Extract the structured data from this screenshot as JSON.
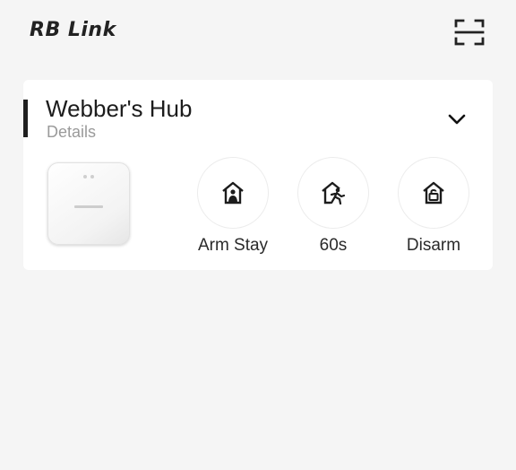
{
  "header": {
    "logo_text": "RB Link",
    "scan_icon": "scan-icon"
  },
  "hub_card": {
    "name": "Webber's Hub",
    "details_label": "Details",
    "expand_icon": "chevron-down-icon"
  },
  "modes": [
    {
      "label": "Arm Stay",
      "icon": "home-person-icon"
    },
    {
      "label": "60s",
      "icon": "home-leave-icon"
    },
    {
      "label": "Disarm",
      "icon": "home-unlock-icon"
    }
  ],
  "colors": {
    "background": "#f5f5f5",
    "card": "#ffffff",
    "accent_bar": "#1f1f1f",
    "text": "#1c1c1c",
    "muted_text": "#9a9a9a"
  }
}
